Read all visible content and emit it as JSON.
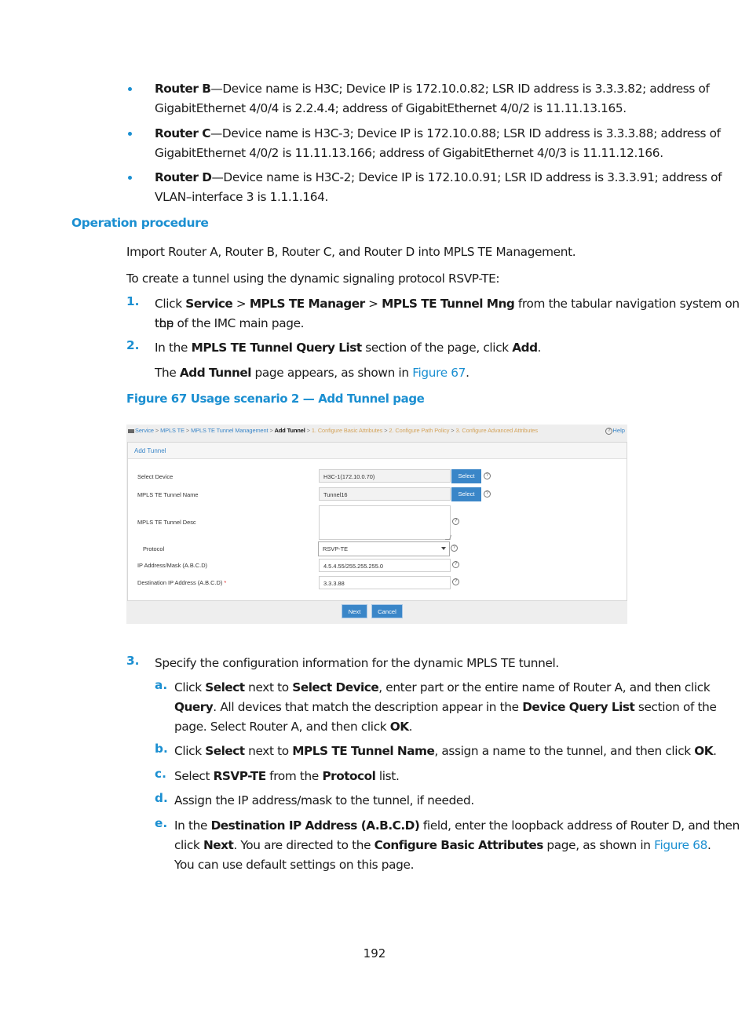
{
  "bullets": [
    {
      "name": "Router B",
      "text_line1": "—Device name is H3C; Device IP is 172.10.0.82; LSR ID address is 3.3.3.82; address of",
      "text_line2": "GigabitEthernet 4/0/4 is 2.2.4.4; address of GigabitEthernet 4/0/2 is 11.11.13.165."
    },
    {
      "name": "Router C",
      "text_line1": "—Device name is H3C-3; Device IP is 172.10.0.88; LSR ID address is 3.3.3.88; address of",
      "text_line2": "GigabitEthernet 4/0/2 is 11.11.13.166; address of GigabitEthernet 4/0/3 is 11.11.12.166."
    },
    {
      "name": "Router D",
      "text_line1": "—Device name is H3C-2; Device IP is 172.10.0.91; LSR ID address is 3.3.3.91; address of",
      "text_line2": "VLAN–interface 3 is 1.1.1.164."
    }
  ],
  "section_heading": "Operation procedure",
  "intro": {
    "p1": "Import Router A, Router B, Router C, and Router D into MPLS TE Management.",
    "p2": "To create a tunnel using the dynamic signaling protocol RSVP-TE:"
  },
  "steps": {
    "s1": {
      "num": "1.",
      "pre": "Click ",
      "b1": "Service",
      "sep1": " > ",
      "b2": "MPLS TE Manager",
      "sep2": " > ",
      "b3": "MPLS TE Tunnel Mng",
      "post": " from the tabular navigation system on the",
      "line2": "top of the IMC main page."
    },
    "s2": {
      "num": "2.",
      "pre": "In the ",
      "b1": "MPLS TE Tunnel Query List",
      "mid": " section of the page, click ",
      "b2": "Add",
      "end": ".",
      "sub_pre": "The ",
      "sub_b": "Add Tunnel",
      "sub_mid": " page appears, as shown in ",
      "sub_link": "Figure 67",
      "sub_end": "."
    },
    "s3": {
      "num": "3.",
      "text": "Specify the configuration information for the dynamic MPLS TE tunnel.",
      "a": {
        "letter": "a.",
        "l1_pre": "Click ",
        "l1_b1": "Select",
        "l1_mid": " next to ",
        "l1_b2": "Select Device",
        "l1_post": ", enter part or the entire name of Router A, and then click",
        "l2_b1": "Query",
        "l2_mid": ". All devices that match the description appear in the ",
        "l2_b2": "Device Query List",
        "l2_post": " section of the",
        "l3_pre": "page. Select Router A, and then click ",
        "l3_b": "OK",
        "l3_end": "."
      },
      "b": {
        "letter": "b.",
        "pre": "Click ",
        "b1": "Select",
        "mid1": " next to ",
        "b2": "MPLS TE Tunnel Name",
        "mid2": ", assign a name to the tunnel, and then click ",
        "b3": "OK",
        "end": "."
      },
      "c": {
        "letter": "c.",
        "pre": "Select ",
        "b1": "RSVP-TE",
        "mid": " from the ",
        "b2": "Protocol",
        "end": " list."
      },
      "d": {
        "letter": "d.",
        "text": "Assign the IP address/mask to the tunnel, if needed."
      },
      "e": {
        "letter": "e.",
        "l1_pre": "In the ",
        "l1_b": "Destination IP Address (A.B.C.D)",
        "l1_post": " field, enter the loopback address of Router D, and then",
        "l2_pre": "click ",
        "l2_b1": "Next",
        "l2_mid": ". You are directed to the ",
        "l2_b2": "Configure Basic Attributes",
        "l2_mid2": " page, as shown in ",
        "l2_link": "Figure 68",
        "l2_end": ".",
        "l3": "You can use default settings on this page."
      }
    }
  },
  "figure_caption": "Figure 67 Usage scenario 2 — Add Tunnel page",
  "screenshot": {
    "breadcrumb": {
      "items": [
        "Service",
        "MPLS TE",
        "MPLS TE Tunnel Management"
      ],
      "current": "Add Tunnel",
      "steps": [
        "1. Configure Basic Attributes",
        "2. Configure Path Policy",
        "3. Configure Advanced Attributes"
      ],
      "separator": ">"
    },
    "help_label": "Help",
    "panel_title": "Add Tunnel",
    "form": {
      "select_device_label": "Select Device",
      "select_device_value": "H3C-1(172.10.0.70)",
      "tunnel_name_label": "MPLS TE Tunnel Name",
      "tunnel_name_value": "Tunnel16",
      "tunnel_desc_label": "MPLS TE Tunnel Desc",
      "tunnel_desc_value": "",
      "protocol_label": "Protocol",
      "protocol_value": "RSVP-TE",
      "ip_mask_label": "IP Address/Mask (A.B.C.D)",
      "ip_mask_value": "4.5.4.55/255.255.255.0",
      "dest_ip_label": "Destination IP Address (A.B.C.D)",
      "dest_ip_required": "*",
      "dest_ip_value": "3.3.3.88",
      "select_button": "Select",
      "help_glyph": "?"
    },
    "buttons": {
      "next": "Next",
      "cancel": "Cancel"
    }
  },
  "page_number": "192"
}
